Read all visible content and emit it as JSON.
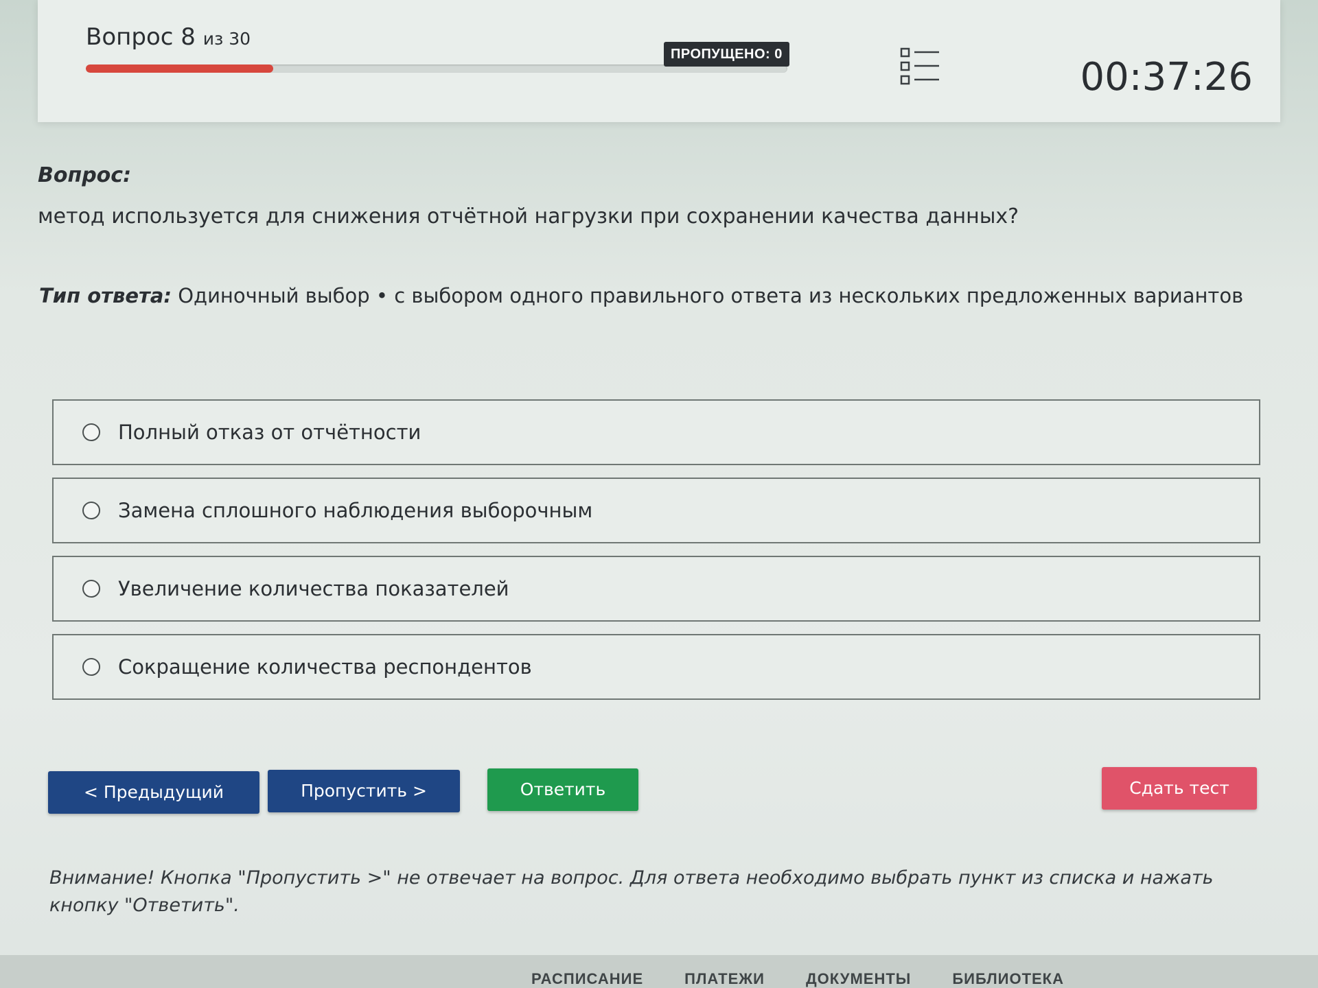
{
  "header": {
    "question_word": "Вопрос",
    "question_number": "8",
    "of_total": "из 30",
    "progress_fraction": 0.267,
    "skipped_badge": "ПРОПУЩЕНО: 0",
    "list_icon": "question-list-icon",
    "timer": "00:37:26"
  },
  "question": {
    "label": "Вопрос:",
    "text": "метод используется для снижения отчётной нагрузки при сохранении качества данных?"
  },
  "answer_type": {
    "label": "Тип ответа:",
    "value": "Одиночный выбор • с выбором одного правильного ответа из нескольких предложенных вариантов"
  },
  "options": [
    {
      "label": "Полный отказ от отчётности"
    },
    {
      "label": "Замена сплошного наблюдения выборочным"
    },
    {
      "label": "Увеличение количества показателей"
    },
    {
      "label": "Сокращение количества респондентов"
    }
  ],
  "buttons": {
    "prev": "< Предыдущий",
    "skip": "Пропустить >",
    "answer": "Ответить",
    "submit": "Сдать тест"
  },
  "warning": "Внимание! Кнопка \"Пропустить >\" не отвечает на вопрос. Для ответа необходимо выбрать пункт из списка и нажать кнопку \"Ответить\".",
  "footer": {
    "links": [
      "РАСПИСАНИЕ",
      "ПЛАТЕЖИ",
      "ДОКУМЕНТЫ",
      "БИБЛИОТЕКА"
    ]
  },
  "colors": {
    "progress": "#d7473d",
    "primary_button": "#1f4684",
    "answer_button": "#1f9a4e",
    "submit_button": "#e05369"
  }
}
